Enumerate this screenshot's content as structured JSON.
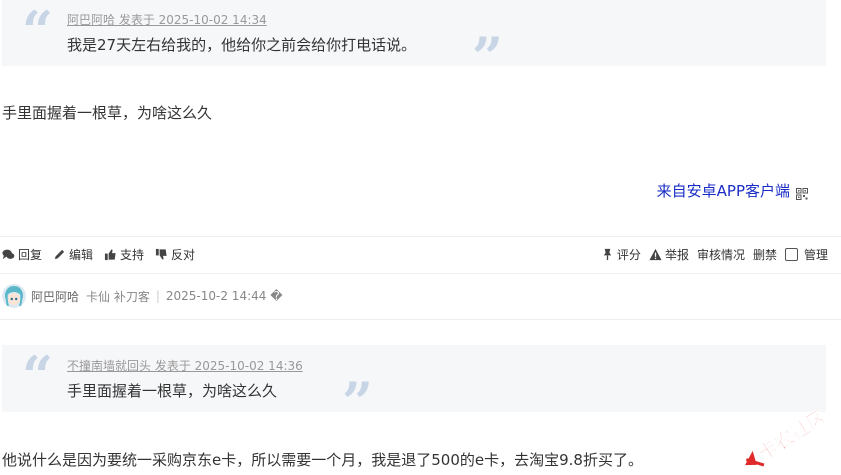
{
  "quote_1": {
    "meta": "阿巴阿哈 发表于 2025-10-02 14:34",
    "text": "我是27天左右给我的，他给你之前会给你打电话说。"
  },
  "post_1": {
    "text": "手里面握着一根草，为啥这么久",
    "source_link": "来自安卓APP客户端"
  },
  "actions": {
    "reply": "回复",
    "edit": "编辑",
    "support": "支持",
    "oppose": "反对",
    "rate": "评分",
    "report": "举报",
    "review_status": "审核情况",
    "ban": "删禁",
    "manage": "管理"
  },
  "reply_info": {
    "user": "阿巴阿哈",
    "rank": "卡仙 补刀客",
    "separator": "|",
    "time": "2025-10-2 14:44 �"
  },
  "quote_2": {
    "meta": "不撞南墙就回头 发表于 2025-10-02 14:36",
    "text": "手里面握着一根草，为啥这么久"
  },
  "post_2": {
    "text": "他说什么是因为要统一采购京东e卡，所以需要一个月，我是退了500的e卡，去淘宝9.8折买了。"
  },
  "watermark": {
    "text": "卡农社区"
  },
  "colors": {
    "quote_bg": "#f6f7f9",
    "quote_mark": "#c8d5e6",
    "link_blue": "#1a2dc6",
    "watermark_red": "#e02a2a"
  }
}
